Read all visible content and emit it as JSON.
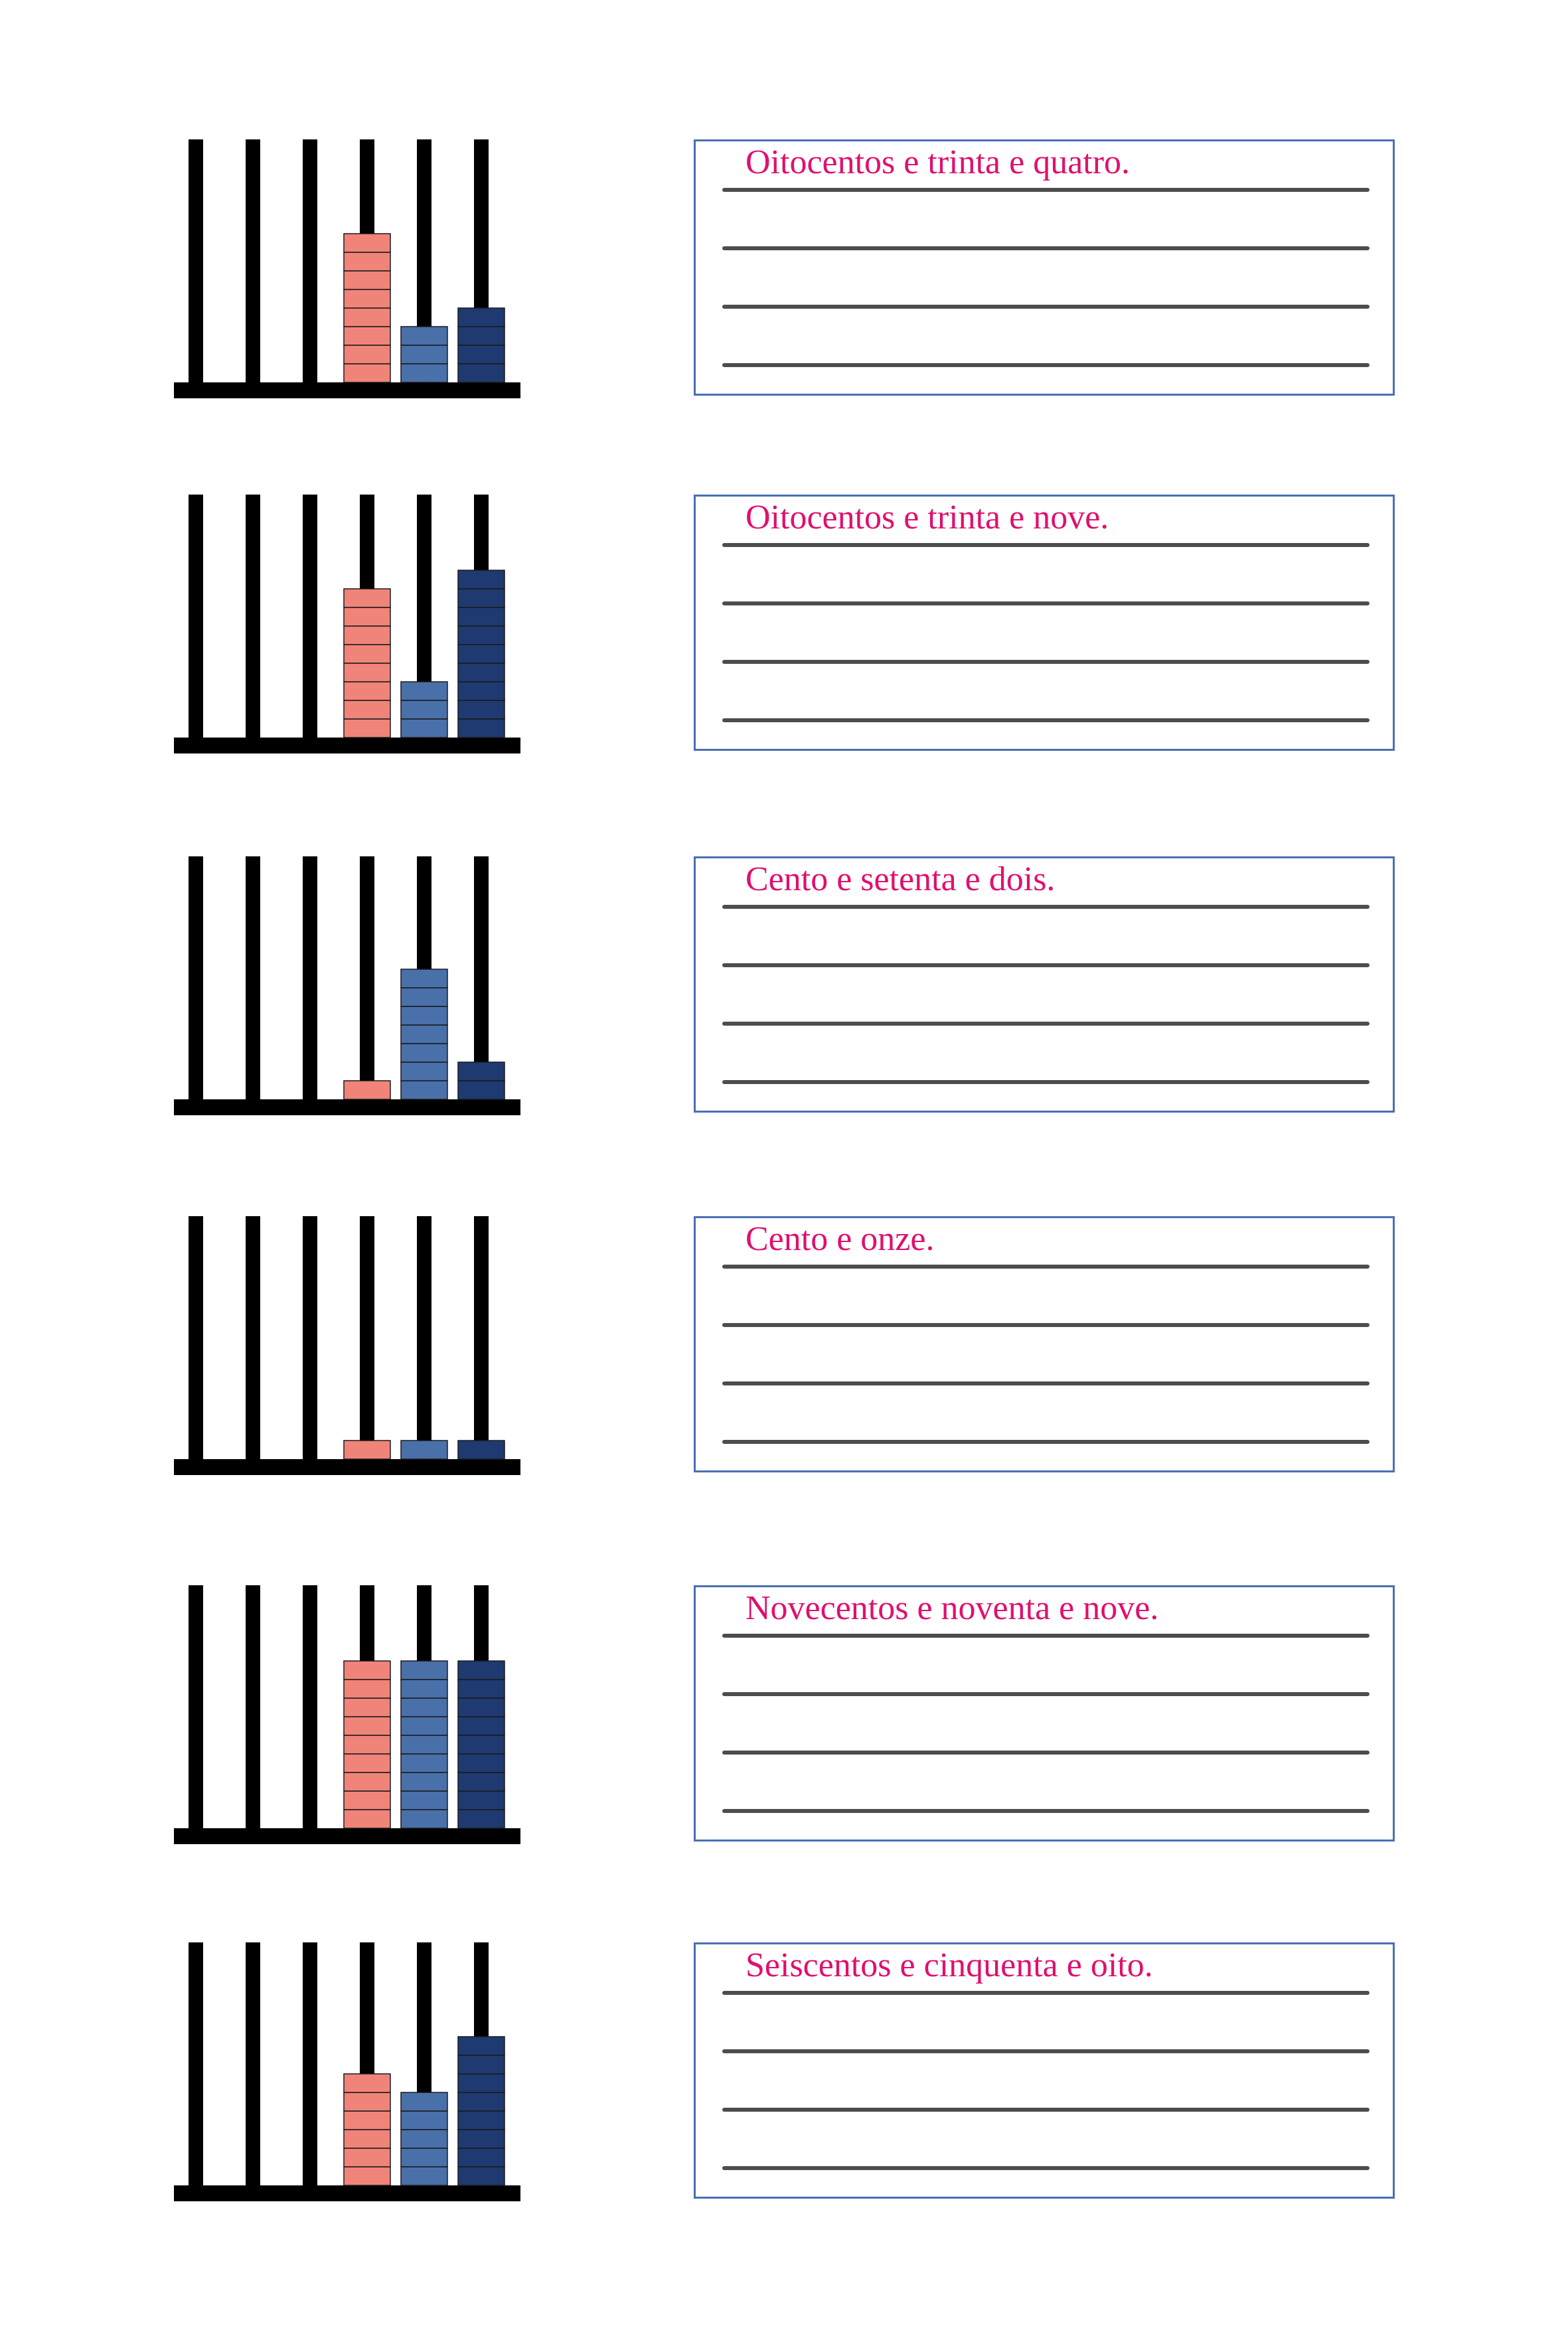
{
  "colors": {
    "hundreds_bead": "#f08478",
    "tens_bead": "#4a70aa",
    "units_bead": "#1f3a70",
    "frame": "#000000",
    "answer_text": "#e0106e",
    "box_border": "#4a6fb5",
    "writing_line": "#4d4d4d"
  },
  "exercises": [
    {
      "abacus": {
        "hundreds": 8,
        "tens": 3,
        "units": 4
      },
      "answer": "Oitocentos e trinta e quatro."
    },
    {
      "abacus": {
        "hundreds": 8,
        "tens": 3,
        "units": 9
      },
      "answer": "Oitocentos e trinta e nove."
    },
    {
      "abacus": {
        "hundreds": 1,
        "tens": 7,
        "units": 2
      },
      "answer": "Cento e setenta e dois."
    },
    {
      "abacus": {
        "hundreds": 1,
        "tens": 1,
        "units": 1
      },
      "answer": "Cento e onze."
    },
    {
      "abacus": {
        "hundreds": 9,
        "tens": 9,
        "units": 9
      },
      "answer": "Novecentos e noventa e nove."
    },
    {
      "abacus": {
        "hundreds": 6,
        "tens": 5,
        "units": 8
      },
      "answer": "Seiscentos e cinquenta e oito."
    }
  ]
}
